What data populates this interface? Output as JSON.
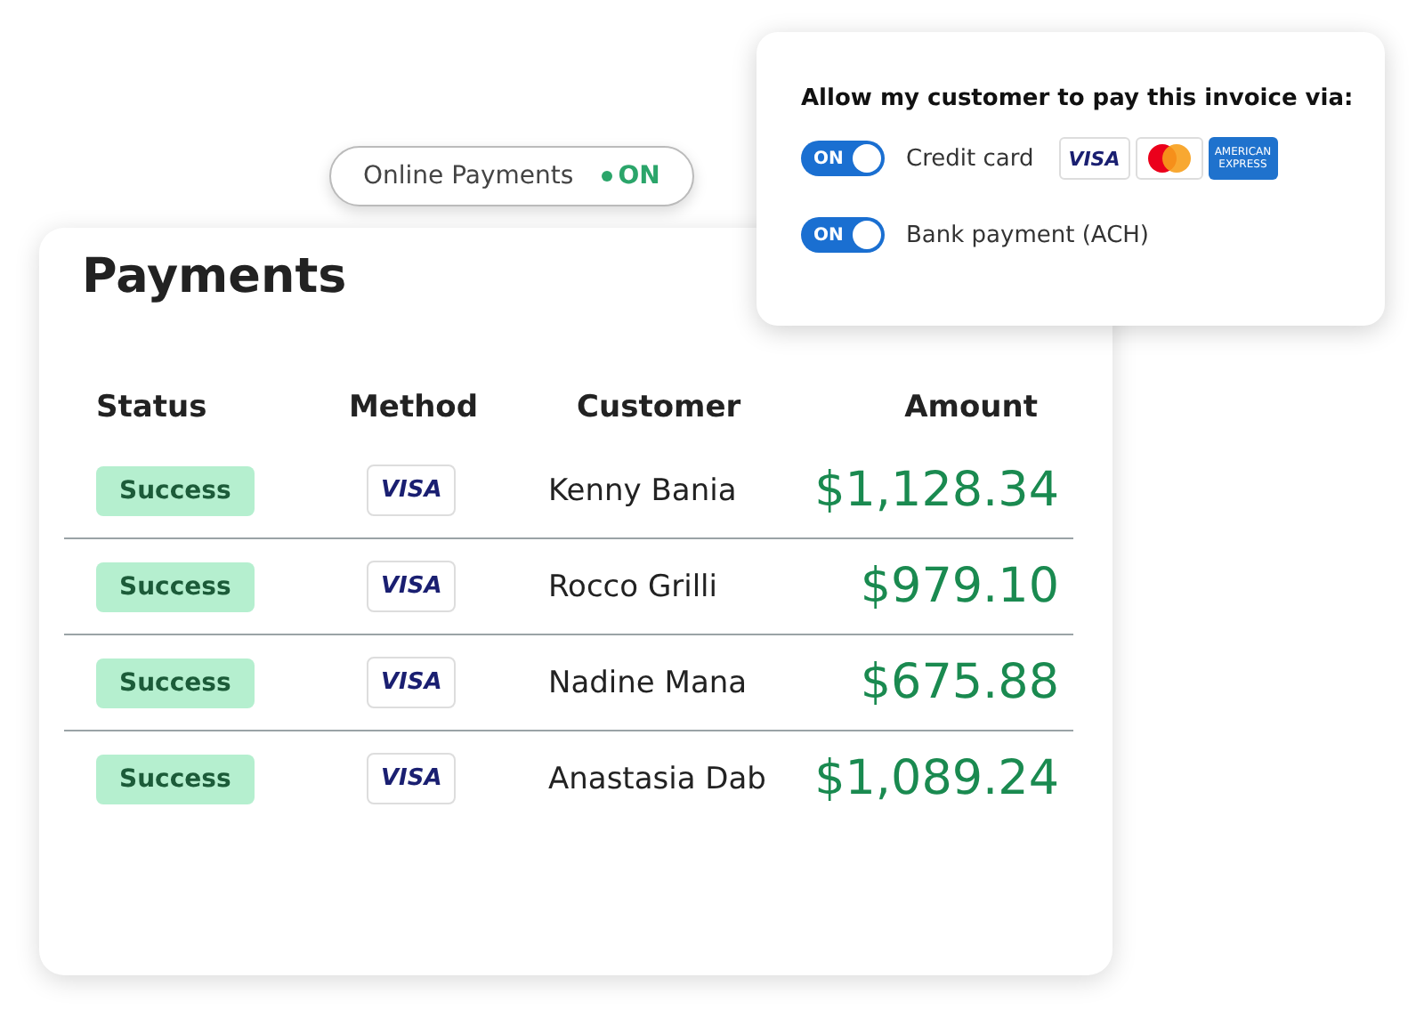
{
  "payments_card": {
    "title": "Payments",
    "columns": [
      "Status",
      "Method",
      "Customer",
      "Amount"
    ],
    "rows": [
      {
        "status": "Success",
        "method": "VISA",
        "customer": "Kenny Bania",
        "amount": "$1,128.34"
      },
      {
        "status": "Success",
        "method": "VISA",
        "customer": "Rocco Grilli",
        "amount": "$979.10"
      },
      {
        "status": "Success",
        "method": "VISA",
        "customer": "Nadine Mana",
        "amount": "$675.88"
      },
      {
        "status": "Success",
        "method": "VISA",
        "customer": "Anastasia Dab",
        "amount": "$1,089.24"
      }
    ]
  },
  "online_payments": {
    "label": "Online Payments",
    "state": "ON",
    "on": true
  },
  "popover": {
    "title": "Allow my customer to pay this invoice via:",
    "options": [
      {
        "kind": "card",
        "label": "Credit card",
        "toggle_label": "ON",
        "on": true,
        "logos": [
          {
            "kind": "visa",
            "text": "VISA"
          },
          {
            "kind": "mastercard"
          },
          {
            "kind": "amex",
            "text": "AMERICAN EXPRESS"
          }
        ]
      },
      {
        "kind": "bank",
        "label": "Bank payment (ACH)",
        "toggle_label": "ON",
        "on": true
      }
    ]
  }
}
